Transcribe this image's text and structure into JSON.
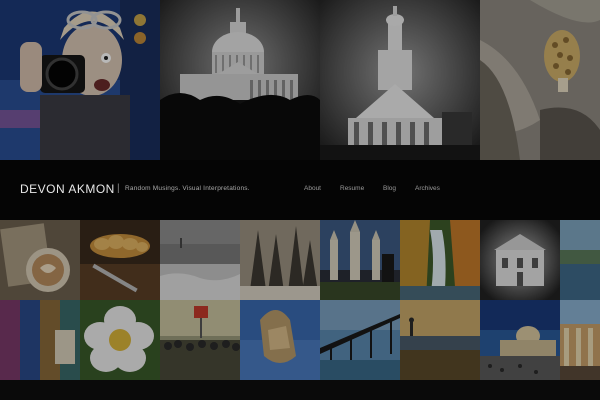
{
  "header": {
    "brand": "DEVON AKMON",
    "separator": "|",
    "tagline": "Random Musings. Visual Interpretations."
  },
  "nav": {
    "items": [
      {
        "label": "About"
      },
      {
        "label": "Resume"
      },
      {
        "label": "Blog"
      },
      {
        "label": "Archives"
      }
    ]
  },
  "gallery": {
    "top_row": [
      {
        "subject": "photographer-with-camera"
      },
      {
        "subject": "capitol-dome"
      },
      {
        "subject": "church-steeple"
      },
      {
        "subject": "morel-mushroom"
      }
    ],
    "bottom_rows": [
      {
        "subject": "coffee-latte"
      },
      {
        "subject": "braided-bread"
      },
      {
        "subject": "foggy-beach"
      },
      {
        "subject": "winter-trees"
      },
      {
        "subject": "new-orleans-cathedral"
      },
      {
        "subject": "waterfall"
      },
      {
        "subject": "old-building"
      },
      {
        "subject": "coastal-landscape"
      },
      {
        "subject": "colorful-textiles"
      },
      {
        "subject": "white-flower"
      },
      {
        "subject": "festival-crowd"
      },
      {
        "subject": "rock-sculpture"
      },
      {
        "subject": "pier-at-sunset"
      },
      {
        "subject": "person-on-beach"
      },
      {
        "subject": "st-peters-basilica"
      },
      {
        "subject": "colonnade-ruins"
      }
    ]
  }
}
